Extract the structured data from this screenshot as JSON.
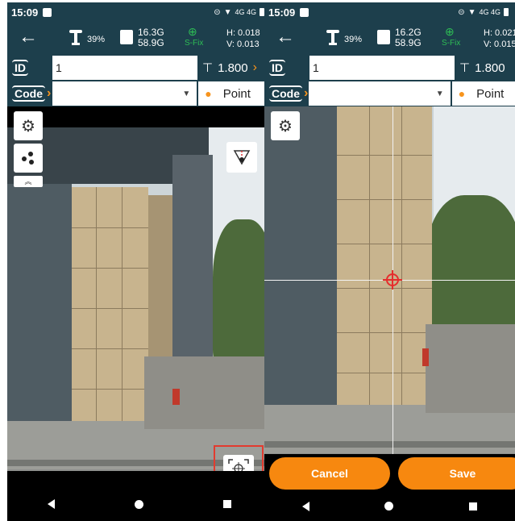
{
  "left": {
    "status": {
      "time": "15:09",
      "network": "4G 4G"
    },
    "appbar": {
      "sat_pct": "39%",
      "mem_top": "16.3G",
      "mem_bottom": "58.9G",
      "fix": "S-Fix",
      "h": "H: 0.018",
      "v": "V: 0.013"
    },
    "id_label": "ID",
    "id_value": "1",
    "antenna_height": "1.800",
    "code_label": "Code",
    "code_value": "",
    "point_label": "Point"
  },
  "right": {
    "status": {
      "time": "15:09",
      "network": "4G 4G"
    },
    "appbar": {
      "sat_pct": "39%",
      "mem_top": "16.2G",
      "mem_bottom": "58.9G",
      "fix": "S-Fix",
      "h": "H: 0.021",
      "v": "V: 0.015"
    },
    "id_label": "ID",
    "id_value": "1",
    "antenna_height": "1.800",
    "code_label": "Code",
    "code_value": "",
    "point_label": "Point",
    "cancel_label": "Cancel",
    "save_label": "Save"
  },
  "colors": {
    "header": "#1d3f4c",
    "accent": "#f7941d",
    "fix": "#2ebd55",
    "highlight": "#e23b2f"
  },
  "icons": [
    "back-arrow-icon",
    "satellite-antenna-icon",
    "sd-card-icon",
    "crosshair-fix-icon",
    "antenna-height-icon",
    "chevron-right-icon",
    "dropdown-arrow-icon",
    "settings-gear-icon",
    "three-dots-icon",
    "double-chevron-up-icon",
    "level-bubble-icon",
    "target-crosshair-icon"
  ]
}
